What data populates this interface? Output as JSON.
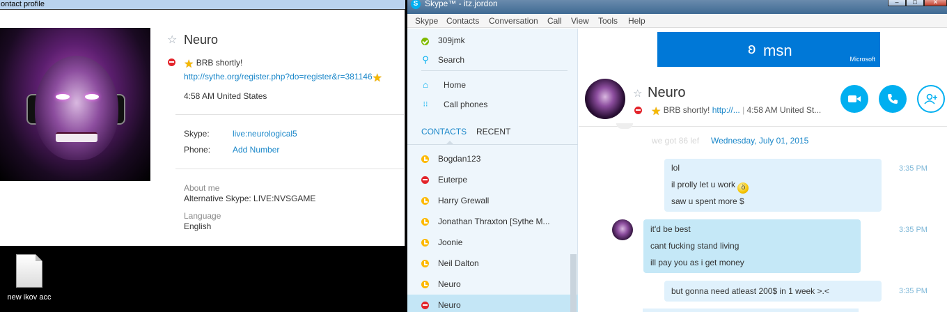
{
  "profile_window": {
    "title": "ontact profile",
    "name": "Neuro",
    "mood": "BRB shortly!",
    "mood_link": "http://sythe.org/register.php?do=register&r=381146",
    "local_time": "4:58 AM United States",
    "skype_label": "Skype:",
    "skype_value": "live:neurological5",
    "phone_label": "Phone:",
    "phone_value": "Add Number",
    "about_label": "About me",
    "about_value": "Alternative Skype:  LIVE:NVSGAME",
    "language_label": "Language",
    "language_value": "English"
  },
  "desktop": {
    "file_label": "new ikov acc"
  },
  "skype_window": {
    "title": "Skype™ - itz.jordon",
    "menu": [
      "Skype",
      "Contacts",
      "Conversation",
      "Call",
      "View",
      "Tools",
      "Help"
    ],
    "sidebar": {
      "user": "309jmk",
      "search": "Search",
      "home": "Home",
      "call_phones": "Call phones",
      "tab_contacts": "CONTACTS",
      "tab_recent": "RECENT",
      "contacts": [
        {
          "name": "Bogdan123",
          "status": "away"
        },
        {
          "name": "Euterpe",
          "status": "busy"
        },
        {
          "name": "Harry Grewall",
          "status": "away"
        },
        {
          "name": "Jonathan Thraxton [Sythe M...",
          "status": "away"
        },
        {
          "name": "Joonie",
          "status": "away"
        },
        {
          "name": "Neil Dalton",
          "status": "away"
        },
        {
          "name": "Neuro",
          "status": "away"
        },
        {
          "name": "Neuro",
          "status": "busy",
          "selected": true
        }
      ]
    },
    "conversation": {
      "ad_brand": "msn",
      "ad_company": "Microsoft",
      "contact_name": "Neuro",
      "mood": "BRB shortly!",
      "mood_link": "http://...",
      "time_location": "4:58 AM United St...",
      "ghost_text": "we got 86 lef",
      "date_separator": "Wednesday, July 01, 2015",
      "messages": [
        {
          "from": "me",
          "lines": [
            "lol",
            "il prolly let u work",
            "saw u spent more $"
          ],
          "time": "3:35 PM"
        },
        {
          "from": "them",
          "lines": [
            "it'd be best",
            "cant fucking stand living",
            "ill pay you as i get money"
          ],
          "time": "3:35 PM"
        },
        {
          "from": "me",
          "lines": [
            "but gonna need atleast 200$ in 1 week >.<"
          ],
          "time": "3:35 PM"
        }
      ]
    }
  },
  "colors": {
    "skype_blue": "#00aff0",
    "link_blue": "#1a87c9",
    "busy_red": "#e3242b",
    "away_yellow": "#fdb900",
    "online_green": "#7fba00",
    "msn_blue": "#0078d7"
  },
  "icons": {
    "video_call": "video-camera-icon",
    "voice_call": "phone-icon",
    "add_people": "add-person-icon",
    "search": "magnifier-icon",
    "home": "house-icon",
    "call_phones": "dialpad-icon"
  }
}
